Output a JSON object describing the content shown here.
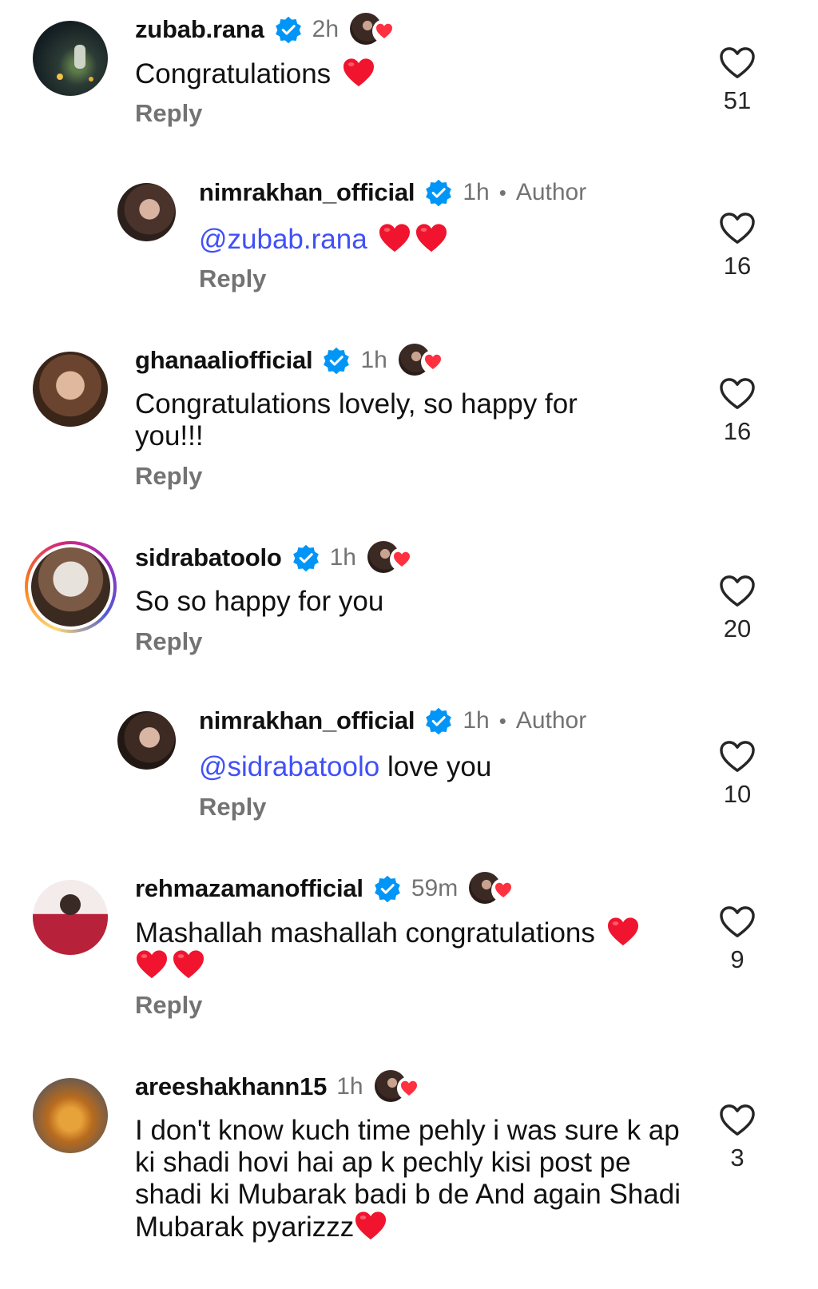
{
  "comments": [
    {
      "username": "zubab.rana",
      "time": "2h",
      "author_label": "",
      "mention": "",
      "text": "Congratulations ",
      "emoji_count": 1,
      "reply_label": "Reply",
      "like_count": "51",
      "verified": true,
      "liked_by_author": true
    },
    {
      "username": "nimrakhan_official",
      "time": "1h",
      "author_label": "Author",
      "mention": "@zubab.rana",
      "text": " ",
      "emoji_count": 2,
      "reply_label": "Reply",
      "like_count": "16",
      "verified": true,
      "liked_by_author": false
    },
    {
      "username": "ghanaaliofficial",
      "time": "1h",
      "author_label": "",
      "mention": "",
      "text": "Congratulations lovely, so happy for you!!!",
      "emoji_count": 0,
      "reply_label": "Reply",
      "like_count": "16",
      "verified": true,
      "liked_by_author": true
    },
    {
      "username": "sidrabatoolo",
      "time": "1h",
      "author_label": "",
      "mention": "",
      "text": "So so happy for you",
      "emoji_count": 0,
      "reply_label": "Reply",
      "like_count": "20",
      "verified": true,
      "liked_by_author": true
    },
    {
      "username": "nimrakhan_official",
      "time": "1h",
      "author_label": "Author",
      "mention": "@sidrabatoolo",
      "text": " love you",
      "emoji_count": 0,
      "reply_label": "Reply",
      "like_count": "10",
      "verified": true,
      "liked_by_author": false
    },
    {
      "username": "rehmazamanofficial",
      "time": "59m",
      "author_label": "",
      "mention": "",
      "text": "Mashallah mashallah congratulations ",
      "emoji_count": 3,
      "reply_label": "Reply",
      "like_count": "9",
      "verified": true,
      "liked_by_author": true
    },
    {
      "username": "areeshakhann15",
      "time": "1h",
      "author_label": "",
      "mention": "",
      "text": "I don't know kuch time pehly i was sure k ap ki shadi hovi hai  ap k pechly kisi post pe shadi ki Mubarak badi b de  And again Shadi Mubarak pyarizzz",
      "emoji_count": 1,
      "reply_label": "",
      "like_count": "3",
      "verified": false,
      "liked_by_author": true
    }
  ],
  "colors": {
    "mention": "#4150f7",
    "verified": "#0095f6",
    "heart": "#ff3040",
    "muted": "#737373"
  },
  "icons": {
    "verified": "verified-badge-icon",
    "like": "heart-outline-icon",
    "emoji": "red-heart-emoji"
  }
}
